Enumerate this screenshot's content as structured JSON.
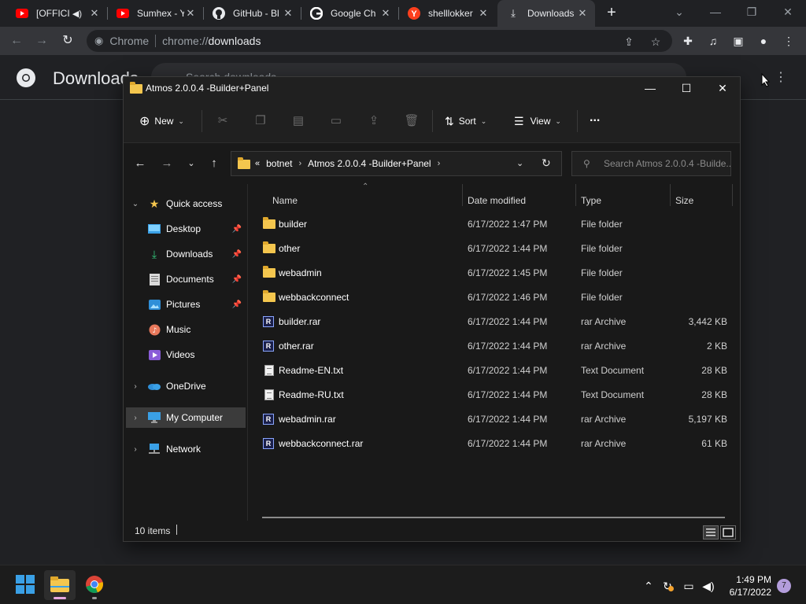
{
  "browser": {
    "tabs": [
      {
        "title": "[OFFICI",
        "favicon": "youtube-icon",
        "audio": true
      },
      {
        "title": "Sumhex - Y",
        "favicon": "youtube-icon"
      },
      {
        "title": "GitHub - Bl",
        "favicon": "github-icon"
      },
      {
        "title": "Google Ch",
        "favicon": "google-icon"
      },
      {
        "title": "shelllokker",
        "favicon": "yandex-icon"
      },
      {
        "title": "Downloads",
        "favicon": "download-icon",
        "active": true
      }
    ],
    "new_tab": "+",
    "omnibox": {
      "site_label": "Chrome",
      "scheme": "chrome://",
      "host": "downloads"
    },
    "downloads_page": {
      "title": "Downloads",
      "search_placeholder": "Search downloads"
    }
  },
  "explorer": {
    "window_title": "Atmos 2.0.0.4 -Builder+Panel",
    "command_bar": {
      "new_label": "New",
      "sort_label": "Sort",
      "view_label": "View",
      "more_label": "..."
    },
    "address": {
      "overflow": "«",
      "crumbs": [
        "botnet",
        "Atmos 2.0.0.4 -Builder+Panel"
      ]
    },
    "search_placeholder": "Search Atmos 2.0.0.4 -Builde...",
    "nav_pane": {
      "quick_access": "Quick access",
      "items": [
        {
          "label": "Desktop",
          "pinned": true
        },
        {
          "label": "Downloads",
          "pinned": true
        },
        {
          "label": "Documents",
          "pinned": true
        },
        {
          "label": "Pictures",
          "pinned": true
        },
        {
          "label": "Music"
        },
        {
          "label": "Videos"
        }
      ],
      "onedrive": "OneDrive",
      "computer": "My Computer",
      "network": "Network"
    },
    "columns": {
      "name": "Name",
      "date": "Date modified",
      "type": "Type",
      "size": "Size"
    },
    "files": [
      {
        "name": "builder",
        "date": "6/17/2022 1:47 PM",
        "type": "File folder",
        "size": "",
        "kind": "folder"
      },
      {
        "name": "other",
        "date": "6/17/2022 1:44 PM",
        "type": "File folder",
        "size": "",
        "kind": "folder"
      },
      {
        "name": "webadmin",
        "date": "6/17/2022 1:45 PM",
        "type": "File folder",
        "size": "",
        "kind": "folder"
      },
      {
        "name": "webbackconnect",
        "date": "6/17/2022 1:46 PM",
        "type": "File folder",
        "size": "",
        "kind": "folder"
      },
      {
        "name": "builder.rar",
        "date": "6/17/2022 1:44 PM",
        "type": "rar Archive",
        "size": "3,442 KB",
        "kind": "rar"
      },
      {
        "name": "other.rar",
        "date": "6/17/2022 1:44 PM",
        "type": "rar Archive",
        "size": "2 KB",
        "kind": "rar"
      },
      {
        "name": "Readme-EN.txt",
        "date": "6/17/2022 1:44 PM",
        "type": "Text Document",
        "size": "28 KB",
        "kind": "txt"
      },
      {
        "name": "Readme-RU.txt",
        "date": "6/17/2022 1:44 PM",
        "type": "Text Document",
        "size": "28 KB",
        "kind": "txt"
      },
      {
        "name": "webadmin.rar",
        "date": "6/17/2022 1:44 PM",
        "type": "rar Archive",
        "size": "5,197 KB",
        "kind": "rar"
      },
      {
        "name": "webbackconnect.rar",
        "date": "6/17/2022 1:44 PM",
        "type": "rar Archive",
        "size": "61 KB",
        "kind": "rar"
      }
    ],
    "status": {
      "item_count": "10 items"
    }
  },
  "taskbar": {
    "time": "1:49 PM",
    "date": "6/17/2022",
    "notification_count": "7"
  }
}
